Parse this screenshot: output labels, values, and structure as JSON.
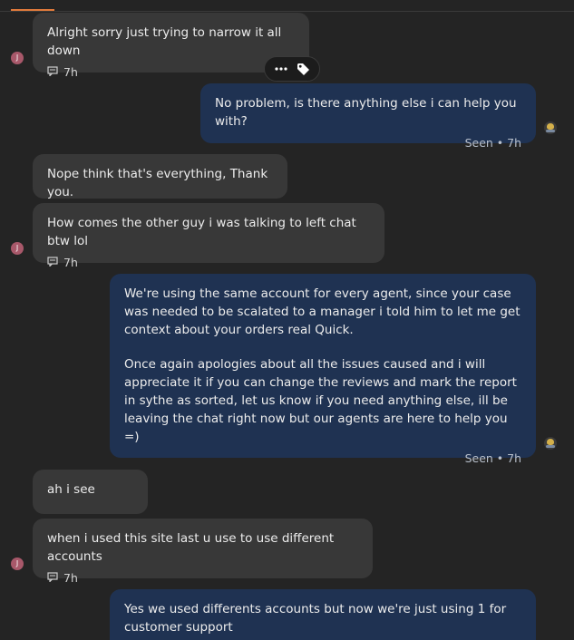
{
  "messages": [
    {
      "text": "Alright sorry just trying to narrow it all down",
      "time": "7h"
    },
    {
      "text": "No problem, is there anything else i can help you with?",
      "status": "Seen • 7h"
    },
    {
      "text": "Nope think that's everything, Thank you."
    },
    {
      "text": "How comes the other guy i was talking to left chat btw lol",
      "time": "7h"
    },
    {
      "para1": "We're using the same account for every agent, since your case was needed to be scalated to a manager i told him to let me get context about your orders real Quick.",
      "para2": "Once again apologies about all the issues caused and i will appreciate it if you can change the reviews and mark the report in sythe as sorted, let us know if you need anything else, ill be leaving the chat right now but our agents are here to help you =)",
      "status": "Seen • 7h"
    },
    {
      "text": "ah i see"
    },
    {
      "text": "when i used this site last u use to use different accounts",
      "time": "7h"
    },
    {
      "text": "Yes we used differents accounts but now we're just using 1 for customer support"
    }
  ],
  "avatar_initial": "J",
  "icons": {
    "reply": "reply-count-icon",
    "more": "more-options-icon",
    "tag": "tag-icon",
    "agent": "agent-avatar-icon"
  },
  "colors": {
    "background": "#242424",
    "incoming_bubble": "#383838",
    "outgoing_bubble": "#1f3252",
    "active_tab": "#e07a3b",
    "avatar": "#a8586a"
  }
}
